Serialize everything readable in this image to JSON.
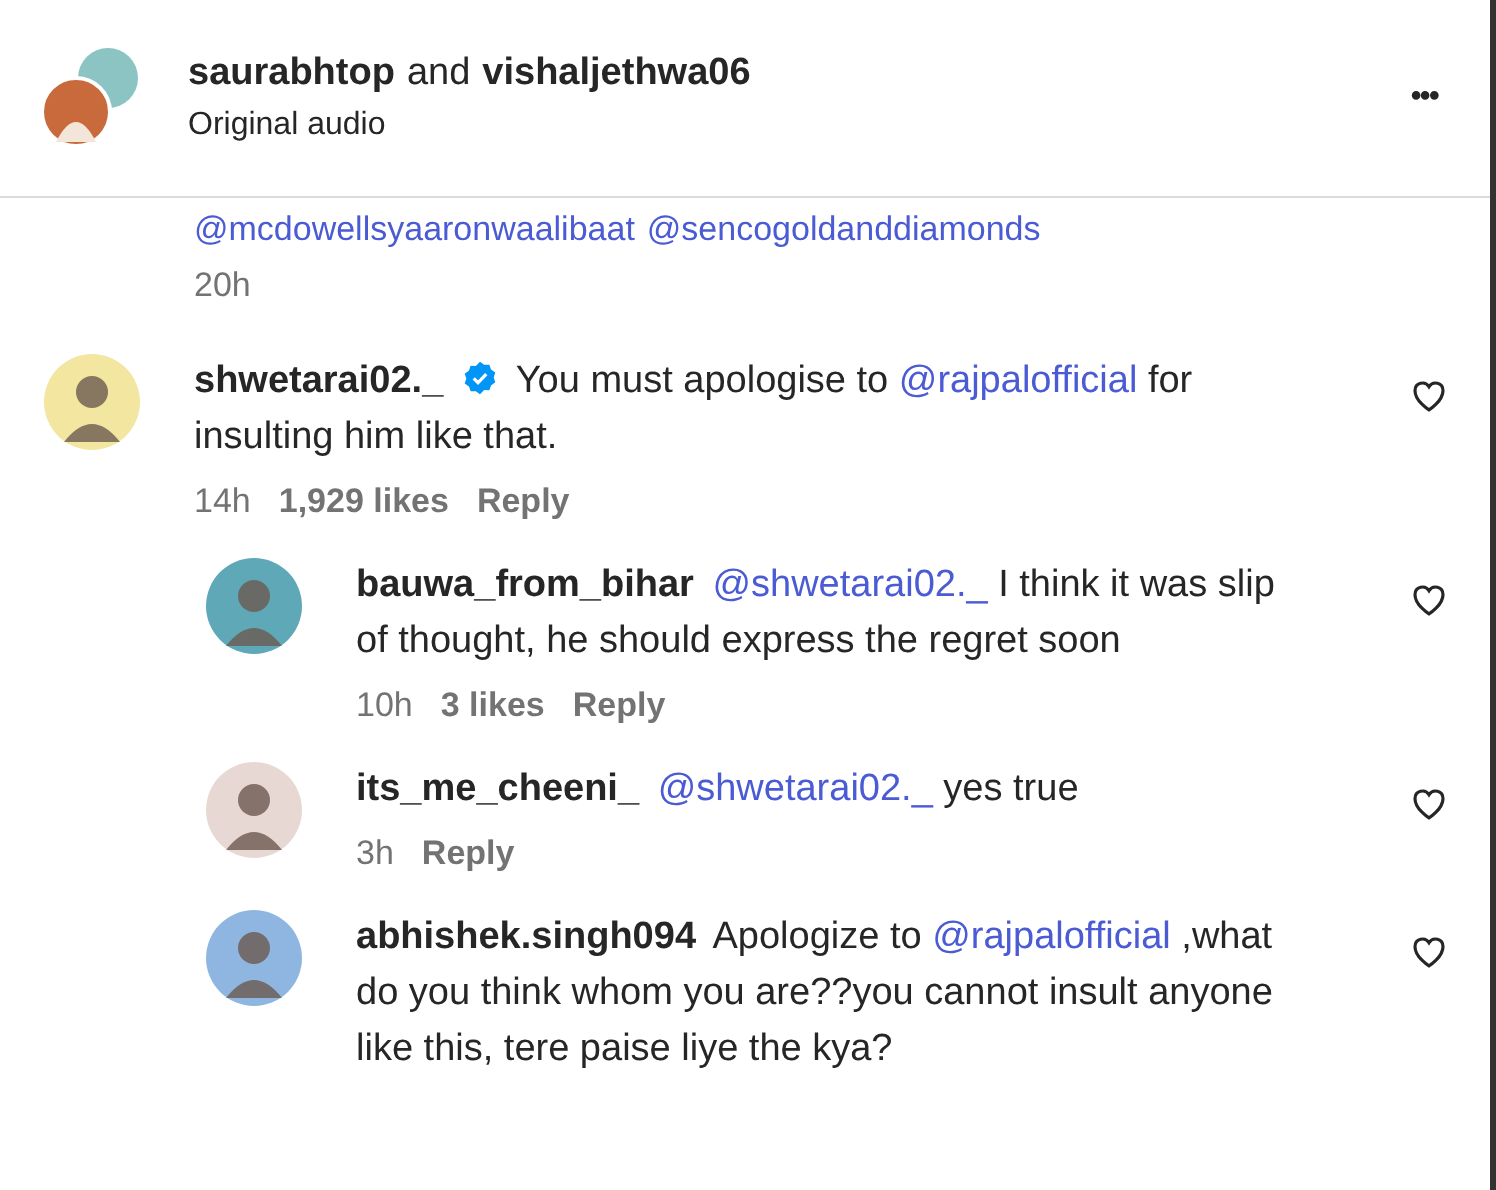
{
  "header": {
    "users": [
      "saurabhtop",
      "vishaljethwa06"
    ],
    "joiner": "and",
    "subtitle": "Original audio",
    "menu": "•••"
  },
  "previous": {
    "mentions": [
      "@mcdowellsyaaronwaalibaat",
      "@sencogoldanddiamonds"
    ],
    "time": "20h"
  },
  "comments": [
    {
      "user": "shwetarai02._",
      "verified": true,
      "parts": [
        {
          "kind": "plain",
          "text": "You must apologise to "
        },
        {
          "kind": "mention",
          "text": "@rajpalofficial"
        },
        {
          "kind": "plain",
          "text": " for insulting him like that."
        }
      ],
      "time": "14h",
      "likes": "1,929 likes",
      "reply": "Reply",
      "liked": false,
      "children": [
        {
          "user": "bauwa_from_bihar",
          "parts": [
            {
              "kind": "mention",
              "text": "@shwetarai02._"
            },
            {
              "kind": "plain",
              "text": " I think it was slip of thought, he should express the regret soon"
            }
          ],
          "time": "10h",
          "likes": "3 likes",
          "reply": "Reply",
          "liked": false
        },
        {
          "user": "its_me_cheeni_",
          "parts": [
            {
              "kind": "mention",
              "text": "@shwetarai02._"
            },
            {
              "kind": "plain",
              "text": " yes true"
            }
          ],
          "time": "3h",
          "reply": "Reply",
          "liked": false
        },
        {
          "user": "abhishek.singh094",
          "parts": [
            {
              "kind": "plain",
              "text": "Apologize to "
            },
            {
              "kind": "mention",
              "text": "@rajpalofficial"
            },
            {
              "kind": "plain",
              "text": " ,what do you think whom you are??you cannot insult anyone like this, tere paise liye the kya?"
            }
          ],
          "liked": false
        }
      ]
    }
  ]
}
